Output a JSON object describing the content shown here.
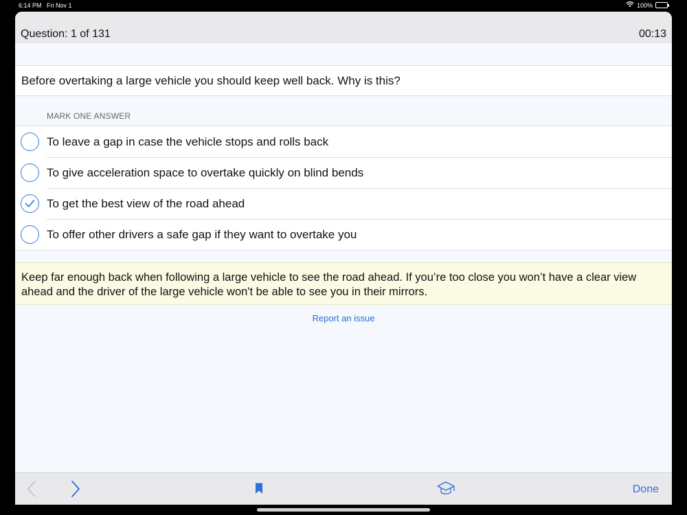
{
  "status_bar": {
    "time": "6:14 PM",
    "date": "Fri Nov 1",
    "battery": "100%"
  },
  "header": {
    "question_counter": "Question: 1 of 131",
    "timer": "00:13"
  },
  "question": {
    "text": "Before overtaking a large vehicle you should keep well back. Why is this?"
  },
  "answers_section": {
    "label": "MARK ONE ANSWER",
    "options": [
      {
        "text": "To leave a gap in case the vehicle stops and rolls back",
        "selected": false
      },
      {
        "text": "To give acceleration space to overtake quickly on blind bends",
        "selected": false
      },
      {
        "text": "To get the best view of the road ahead",
        "selected": true
      },
      {
        "text": "To offer other drivers a safe gap if they want to overtake you",
        "selected": false
      }
    ]
  },
  "explanation": {
    "text": "Keep far enough back when following a large vehicle to see the road ahead. If you’re too close you won’t have a clear view ahead and the driver of the large vehicle won't be able to see you in their mirrors."
  },
  "report_link": "Report an issue",
  "toolbar": {
    "back_icon": "chevron-left-icon",
    "forward_icon": "chevron-right-icon",
    "bookmark_icon": "bookmark-icon",
    "learn_icon": "graduation-cap-icon",
    "done_label": "Done"
  },
  "colors": {
    "accent": "#2f7bd6",
    "explanation_bg": "#fbfbe4",
    "toolbar_bg": "#e9e9eb"
  }
}
